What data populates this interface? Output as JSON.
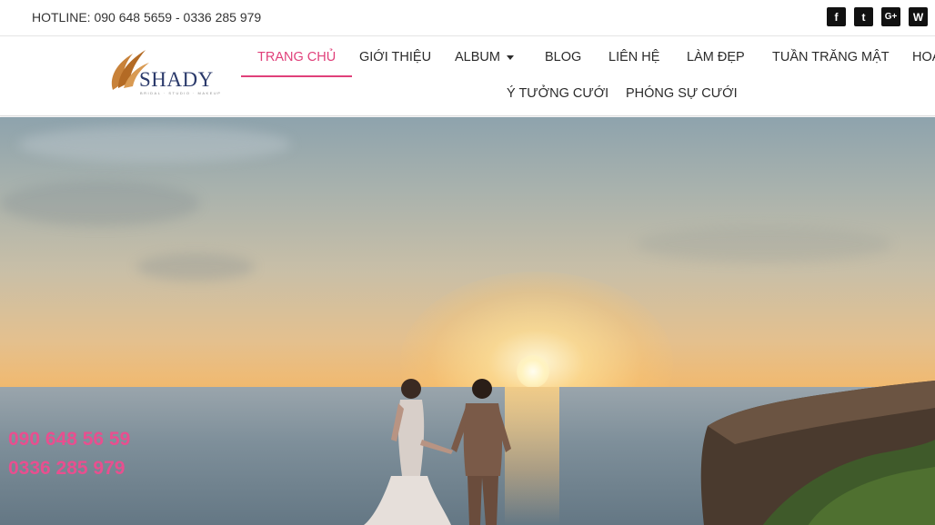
{
  "topbar": {
    "hotline": "HOTLINE: 090 648 5659 - 0336 285 979",
    "socials": [
      {
        "icon": "facebook-icon",
        "glyph": "f"
      },
      {
        "icon": "twitter-icon",
        "glyph": "t"
      },
      {
        "icon": "google-plus-icon",
        "glyph": "G+"
      },
      {
        "icon": "wordpress-icon",
        "glyph": "W"
      }
    ]
  },
  "logo": {
    "name": "SHADY",
    "tagline": "BRIDAL · STUDIO · MAKEUP"
  },
  "nav": {
    "items": [
      {
        "label": "TRANG CHỦ",
        "active": true
      },
      {
        "label": "GIỚI THIỆU"
      },
      {
        "label": "ALBUM",
        "has_dropdown": true
      },
      {
        "label": "BLOG"
      },
      {
        "label": "LIÊN HỆ"
      },
      {
        "label": "LÀM ĐẸP"
      },
      {
        "label": "TUẦN TRĂNG MẬT"
      },
      {
        "label": "HOA"
      },
      {
        "label": "Ý TƯỞNG CƯỚI"
      },
      {
        "label": "PHÓNG SỰ CƯỚI"
      }
    ]
  },
  "hero": {
    "phone1": "090 648 56 59",
    "phone2": "0336 285 979"
  },
  "colors": {
    "accent": "#e0407a",
    "phone_text": "#e84f8f"
  }
}
